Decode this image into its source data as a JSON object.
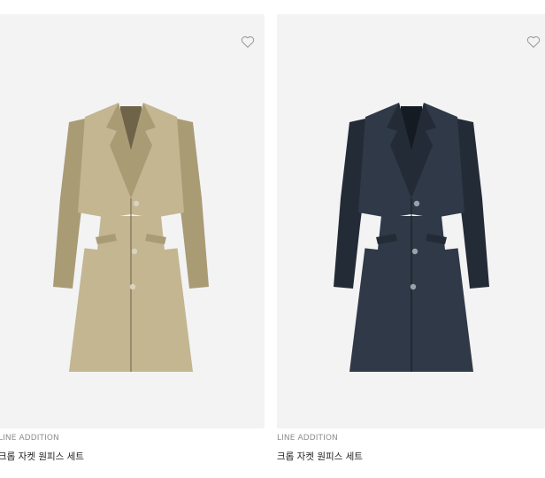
{
  "products": [
    {
      "brand": "LINE ADDITION",
      "name": "크롭 자켓 원피스 세트",
      "colors": {
        "body": "#c3b691",
        "shade": "#a99b74",
        "dark": "#6f6349",
        "button": "#d9d2bf"
      }
    },
    {
      "brand": "LINE ADDITION",
      "name": "크롭 자켓 원피스 세트",
      "colors": {
        "body": "#2f3947",
        "shade": "#232b36",
        "dark": "#151b22",
        "button": "#9aa1aa"
      }
    }
  ],
  "wishlist_icon": "heart-outline-icon"
}
